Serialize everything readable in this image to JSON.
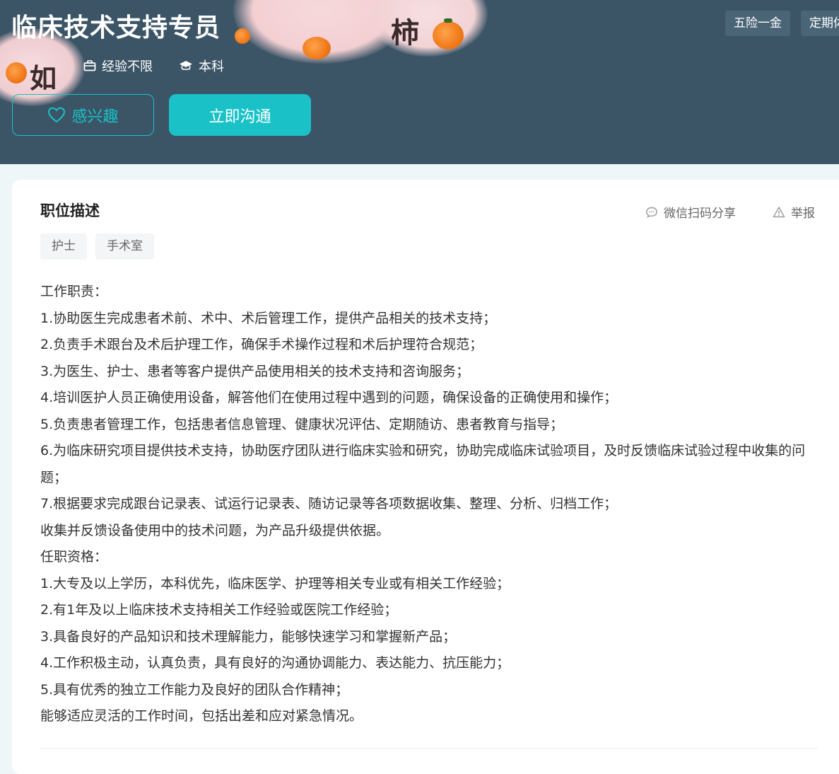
{
  "header": {
    "job_title": "临床技术支持专员",
    "experience": "经验不限",
    "education": "本科",
    "interest_label": "感兴趣",
    "chat_label": "立即沟通",
    "benefits": [
      "五险一金",
      "定期体检"
    ],
    "background_color": "#3b5567",
    "accent_color": "#1ac2c8",
    "deco_chars": [
      "柿",
      "如"
    ]
  },
  "card": {
    "section_title": "职位描述",
    "share_label": "微信扫码分享",
    "report_label": "举报",
    "tags": [
      "护士",
      "手术室"
    ],
    "description_lines": [
      "工作职责：",
      "1.协助医生完成患者术前、术中、术后管理工作，提供产品相关的技术支持；",
      "2.负责手术跟台及术后护理工作，确保手术操作过程和术后护理符合规范；",
      "3.为医生、护士、患者等客户提供产品使用相关的技术支持和咨询服务；",
      "4.培训医护人员正确使用设备，解答他们在使用过程中遇到的问题，确保设备的正确使用和操作；",
      "5.负责患者管理工作，包括患者信息管理、健康状况评估、定期随访、患者教育与指导；",
      "6.为临床研究项目提供技术支持，协助医疗团队进行临床实验和研究，协助完成临床试验项目，及时反馈临床试验过程中收集的问题；",
      "7.根据要求完成跟台记录表、试运行记录表、随访记录等各项数据收集、整理、分析、归档工作；",
      "收集并反馈设备使用中的技术问题，为产品升级提供依据。",
      "任职资格：",
      "1.大专及以上学历，本科优先，临床医学、护理等相关专业或有相关工作经验；",
      "2.有1年及以上临床技术支持相关工作经验或医院工作经验；",
      "3.具备良好的产品知识和技术理解能力，能够快速学习和掌握新产品；",
      "4.工作积极主动，认真负责，具有良好的沟通协调能力、表达能力、抗压能力；",
      "5.具有优秀的独立工作能力及良好的团队合作精神；",
      "能够适应灵活的工作时间，包括出差和应对紧急情况。"
    ]
  },
  "icons": {
    "experience": "briefcase-icon",
    "education": "graduation-cap-icon",
    "interest": "heart-icon",
    "share": "chat-bubble-icon",
    "report": "warning-icon"
  }
}
